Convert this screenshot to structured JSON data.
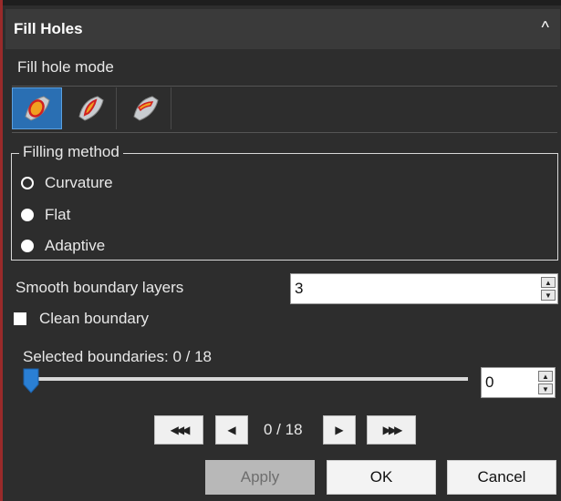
{
  "panel": {
    "title": "Fill Holes",
    "collapse_glyph": "^"
  },
  "fill_hole_mode": {
    "label": "Fill hole mode",
    "modes": [
      {
        "icon": "fill-hole-complete-icon",
        "active": true
      },
      {
        "icon": "fill-hole-partial-icon",
        "active": false
      },
      {
        "icon": "fill-hole-bridge-icon",
        "active": false
      }
    ]
  },
  "filling_method": {
    "legend": "Filling method",
    "options": [
      {
        "label": "Curvature",
        "selected": true
      },
      {
        "label": "Flat",
        "selected": false
      },
      {
        "label": "Adaptive",
        "selected": false
      }
    ]
  },
  "smooth_boundary": {
    "label": "Smooth boundary layers",
    "value": "3"
  },
  "clean_boundary": {
    "label": "Clean boundary",
    "checked": false
  },
  "selected_boundaries": {
    "label": "Selected boundaries: 0 / 18",
    "slider_value": 0,
    "slider_max": 18,
    "spin_value": "0"
  },
  "navigation": {
    "first_glyph": "◀◀◀",
    "prev_glyph": "◀",
    "position_text": "0 / 18",
    "next_glyph": "▶",
    "last_glyph": "▶▶▶"
  },
  "footer": {
    "apply_label": "Apply",
    "ok_label": "OK",
    "cancel_label": "Cancel"
  },
  "colors": {
    "background": "#2d2d2d",
    "header": "#3a3a3a",
    "accent_active": "#2a6fb3",
    "left_border": "#9a2a2a"
  }
}
